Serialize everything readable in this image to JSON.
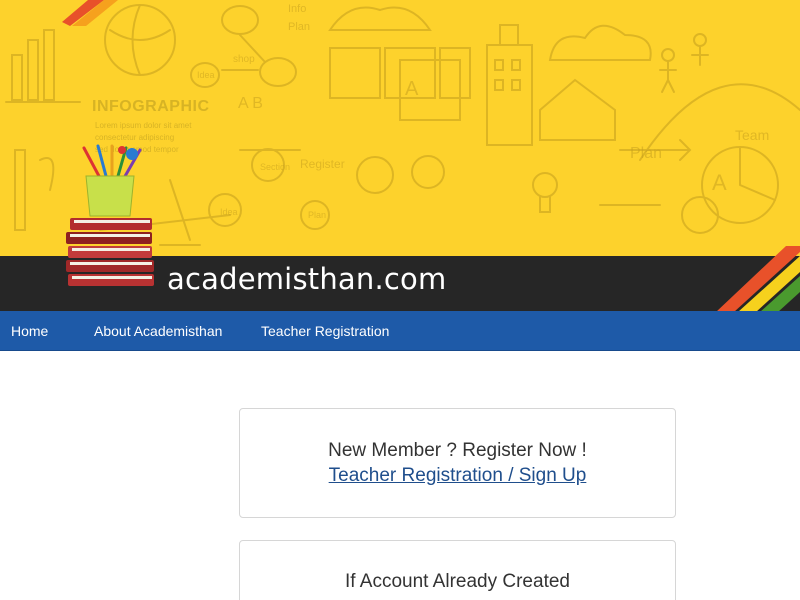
{
  "header": {
    "site_title": "academisthan.com",
    "banner_color": "#fdd22c",
    "title_bar_color": "#262626",
    "doodles": {
      "infographic": "INFOGRAPHIC",
      "lorem_1": "Lorem ipsum dolor sit amet",
      "lorem_2": "consectetur adipiscing",
      "lorem_3": "sed do eiusmod tempor"
    }
  },
  "nav": {
    "color": "#1e5aa8",
    "items": [
      {
        "label": "Home"
      },
      {
        "label": "About Academisthan"
      },
      {
        "label": "Teacher Registration"
      }
    ]
  },
  "register_box": {
    "prompt": "New Member ? Register Now !",
    "link_text": "Teacher Registration / Sign Up"
  },
  "login_box": {
    "prompt": "If Account Already Created"
  }
}
